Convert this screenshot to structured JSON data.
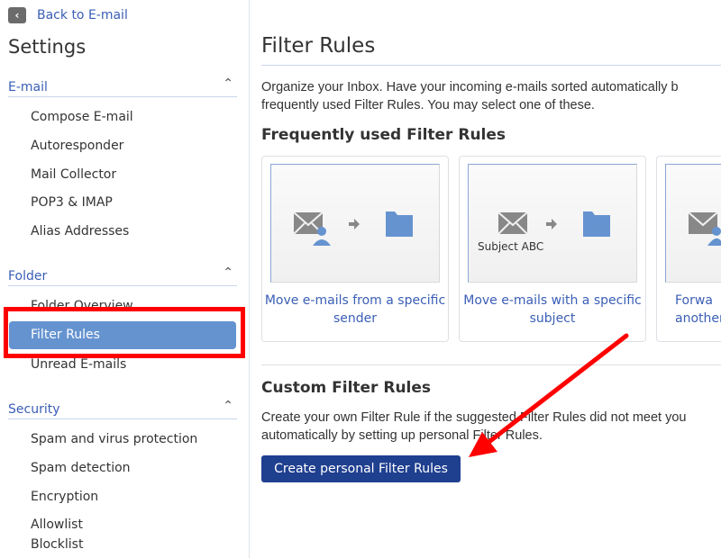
{
  "sidebar": {
    "back_label": "Back to E-mail",
    "title": "Settings",
    "sections": [
      {
        "label": "E-mail",
        "items": [
          "Compose E-mail",
          "Autoresponder",
          "Mail Collector",
          "POP3 & IMAP",
          "Alias Addresses"
        ]
      },
      {
        "label": "Folder",
        "items": [
          "Folder Overview",
          "Filter Rules",
          "Unread E-mails"
        ],
        "selected": "Filter Rules"
      },
      {
        "label": "Security",
        "items": [
          "Spam and virus protection",
          "Spam detection",
          "Encryption",
          "Allowlist",
          "Blocklist"
        ]
      }
    ]
  },
  "main": {
    "title": "Filter Rules",
    "intro": [
      "Organize your Inbox. Have your incoming e-mails sorted automatically b",
      "frequently used Filter Rules. You may select one of these."
    ],
    "frequent_heading": "Frequently used Filter Rules",
    "cards": [
      {
        "caption": "Move e-mails from a specific sender",
        "icon": "envelope-user-to-folder"
      },
      {
        "caption": "Move e-mails with a specific subject",
        "subject_label": "Subject ABC",
        "icon": "envelope-to-folder"
      },
      {
        "caption": "Forwa another",
        "icon": "envelope-user"
      }
    ],
    "custom_heading": "Custom Filter Rules",
    "custom_text": [
      "Create your own Filter Rule if the suggested Filter Rules did not meet you",
      "automatically by setting up personal Filter Rules."
    ],
    "create_button": "Create personal Filter Rules"
  },
  "colors": {
    "accent": "#3a5eb5",
    "selected": "#6593d0",
    "button": "#1f3f8f",
    "annotation": "#ff0000"
  }
}
